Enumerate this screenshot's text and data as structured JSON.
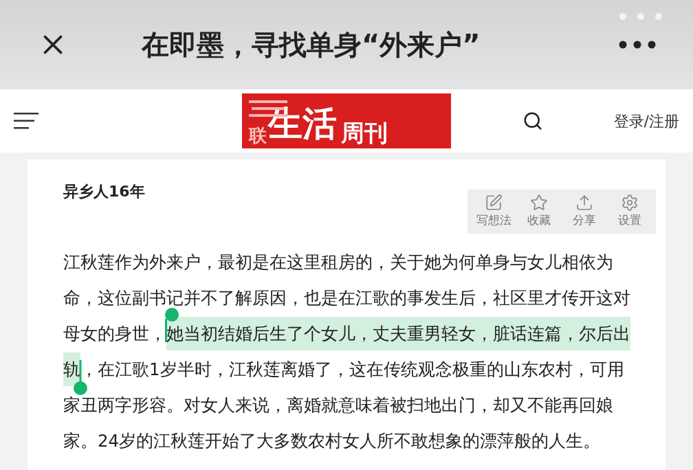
{
  "top_bar": {
    "title": "在即墨，寻找单身“外来户”"
  },
  "site_header": {
    "logo": {
      "small": "联",
      "main": "生活",
      "sub": "周刊"
    },
    "login": "登录/注册"
  },
  "article": {
    "heading": "异乡人16年",
    "toolbar": [
      {
        "label": "写想法",
        "kind": "note"
      },
      {
        "label": "收藏",
        "kind": "star"
      },
      {
        "label": "分享",
        "kind": "share"
      },
      {
        "label": "设置",
        "kind": "settings"
      }
    ],
    "paragraph": [
      {
        "text": "江秋莲作为外来户，最初是在这里租房的，关于她为何单身与女儿相依为命，这位副书记并不了解原因，也是在江歌的事发生后，社区里才传开这对母女的身世，",
        "selected": false
      },
      {
        "text": "她当初结婚后生了个女儿，丈夫重男轻女，脏话连篇，尔后出",
        "selected": true
      },
      {
        "text": "轨",
        "selected": true
      },
      {
        "text": "，在江歌1岁半时，江秋莲离婚了，这在传统观念极重的山东农村，可用家丑两字形容。对女人来说，离婚就意味着被扫地出门，却又不能再回娘家。24岁的江秋莲开始了大多数农村女人所不敢想象的漂萍般的人生。",
        "selected": false
      }
    ]
  }
}
